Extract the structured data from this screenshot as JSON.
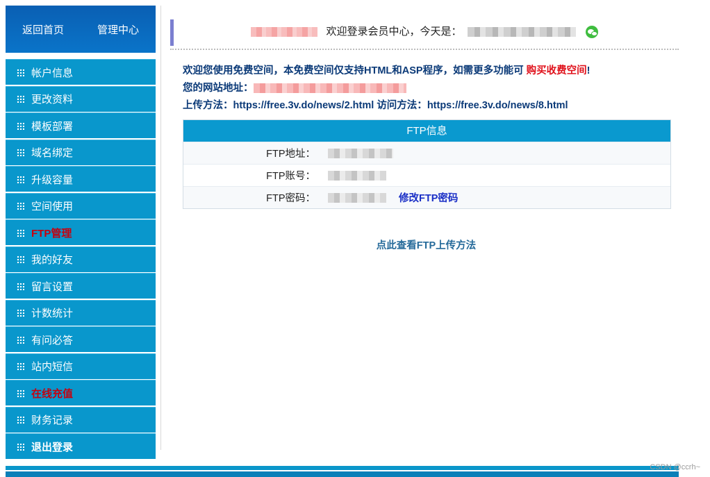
{
  "sidebar": {
    "head": {
      "home": "返回首页",
      "center": "管理中心"
    },
    "items": [
      {
        "label": "帐户信息",
        "style": ""
      },
      {
        "label": "更改资料",
        "style": ""
      },
      {
        "label": "模板部署",
        "style": ""
      },
      {
        "label": "域名绑定",
        "style": ""
      },
      {
        "label": "升级容量",
        "style": ""
      },
      {
        "label": "空间使用",
        "style": ""
      },
      {
        "label": "FTP管理",
        "style": "hl"
      },
      {
        "label": "我的好友",
        "style": ""
      },
      {
        "label": "留言设置",
        "style": ""
      },
      {
        "label": "计数统计",
        "style": ""
      },
      {
        "label": "有问必答",
        "style": ""
      },
      {
        "label": "站内短信",
        "style": ""
      },
      {
        "label": "在线充值",
        "style": "hl"
      },
      {
        "label": "财务记录",
        "style": ""
      },
      {
        "label": "退出登录",
        "style": "bold"
      }
    ]
  },
  "header": {
    "welcome": "欢迎登录会员中心，今天是："
  },
  "info": {
    "line1": "欢迎您使用免费空间，本免费空间仅支持HTML和ASP程序，如需更多功能可",
    "buy_link": "购买收费空间",
    "line1_end": "!",
    "site_label": "您的网站地址：",
    "upload_label": "上传方法：",
    "upload_url": "https://free.3v.do/news/2.html",
    "visit_label": "访问方法：",
    "visit_url": "https://free.3v.do/news/8.html"
  },
  "ftp": {
    "title": "FTP信息",
    "addr_label": "FTP地址：",
    "account_label": "FTP账号：",
    "pwd_label": "FTP密码：",
    "change_pwd": "修改FTP密码"
  },
  "howto": "点此查看FTP上传方法",
  "watermark": "CSDN @ccrh~"
}
